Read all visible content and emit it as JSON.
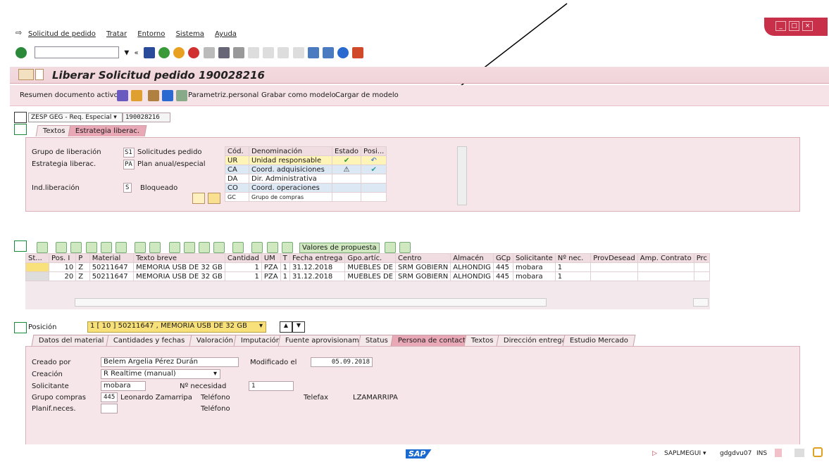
{
  "menu": [
    "Solicitud de pedido",
    "Tratar",
    "Entorno",
    "Sistema",
    "Ayuda"
  ],
  "title": "Liberar Solicitud pedido 190028216",
  "appbar": {
    "resumen": "Resumen documento activo",
    "parametriz": "Parametriz.personal",
    "grabar": "Grabar como modelo",
    "cargar": "Cargar de modelo"
  },
  "header": {
    "doc_type": "ZESP GEG - Req. Especial",
    "doc_number": "190028216"
  },
  "tabs_top": [
    "Textos",
    "Estrategia liberac."
  ],
  "liberacion": {
    "grupo_label": "Grupo de liberación",
    "grupo_code": "S1",
    "grupo_desc": "Solicitudes pedido",
    "estrategia_label": "Estrategia liberac.",
    "estrategia_code": "PA",
    "estrategia_desc": "Plan anual/especial",
    "ind_label": "Ind.liberación",
    "ind_code": "S",
    "ind_desc": "Bloqueado"
  },
  "release_table": {
    "headers": [
      "Cód.",
      "Denominación",
      "Estado",
      "Posi..."
    ],
    "rows": [
      [
        "UR",
        "Unidad responsable",
        "check",
        "undo"
      ],
      [
        "CA",
        "Coord. adquisiciones",
        "warn",
        "release"
      ],
      [
        "DA",
        "Dir. Administrativa",
        "",
        ""
      ],
      [
        "CO",
        "Coord. operaciones",
        "",
        ""
      ],
      [
        "GC",
        "Grupo de compras",
        "",
        ""
      ]
    ]
  },
  "items_toolbar": {
    "valores": "Valores de propuesta"
  },
  "items_table": {
    "headers": [
      "St...",
      "Pos. I",
      "P",
      "Material",
      "Texto breve",
      "Cantidad",
      "UM",
      "T",
      "Fecha entrega",
      "Gpo.artíc.",
      "Centro",
      "Almacén",
      "GCp",
      "Solicitante",
      "Nº nec.",
      "ProvDesead",
      "Amp. Contrato",
      "Prc"
    ],
    "rows": [
      [
        "",
        "10",
        "Z",
        "50211647",
        "MEMORIA USB DE 32 GB",
        "1",
        "PZA",
        "1",
        "31.12.2018",
        "MUEBLES DE",
        "SRM GOBIERN",
        "ALHONDIG",
        "445",
        "mobara",
        "1",
        "",
        "",
        ""
      ],
      [
        "",
        "20",
        "Z",
        "50211647",
        "MEMORIA USB DE 32 GB",
        "1",
        "PZA",
        "1",
        "31.12.2018",
        "MUEBLES DE",
        "SRM GOBIERN",
        "ALHONDIG",
        "445",
        "mobara",
        "1",
        "",
        "",
        ""
      ]
    ]
  },
  "posicion": {
    "label": "Posición",
    "value": "1 [ 10 ] 50211647 , MEMORIA USB DE 32 GB"
  },
  "tabs_bottom": [
    "Datos del material",
    "Cantidades y fechas",
    "Valoración",
    "Imputación",
    "Fuente aprovisionam.",
    "Status",
    "Persona de contacto",
    "Textos",
    "Dirección entrega",
    "Estudio Mercado"
  ],
  "contacto": {
    "creado_label": "Creado por",
    "creado_value": "Belem Argelia Pérez Durán",
    "modificado_label": "Modificado el",
    "modificado_value": "05.09.2018",
    "creacion_label": "Creación",
    "creacion_value": "R Realtime (manual)",
    "solicitante_label": "Solicitante",
    "solicitante_value": "mobara",
    "nnec_label": "Nº necesidad",
    "nnec_value": "1",
    "grupo_label": "Grupo compras",
    "grupo_code": "445",
    "grupo_name": "Leonardo Zamarripa",
    "telefono_label": "Teléfono",
    "telefax_label": "Telefax",
    "telefax_value": "LZAMARRIPA",
    "planif_label": "Planif.neces.",
    "telefono2_label": "Teléfono"
  },
  "status": {
    "sap": "SAP",
    "program": "SAPLMEGUI",
    "server": "gdgdvu07",
    "mode": "INS"
  },
  "colors": {
    "accent": "#c8304a",
    "panel": "#f6e6ea",
    "tab_active": "#e9a8b5"
  }
}
